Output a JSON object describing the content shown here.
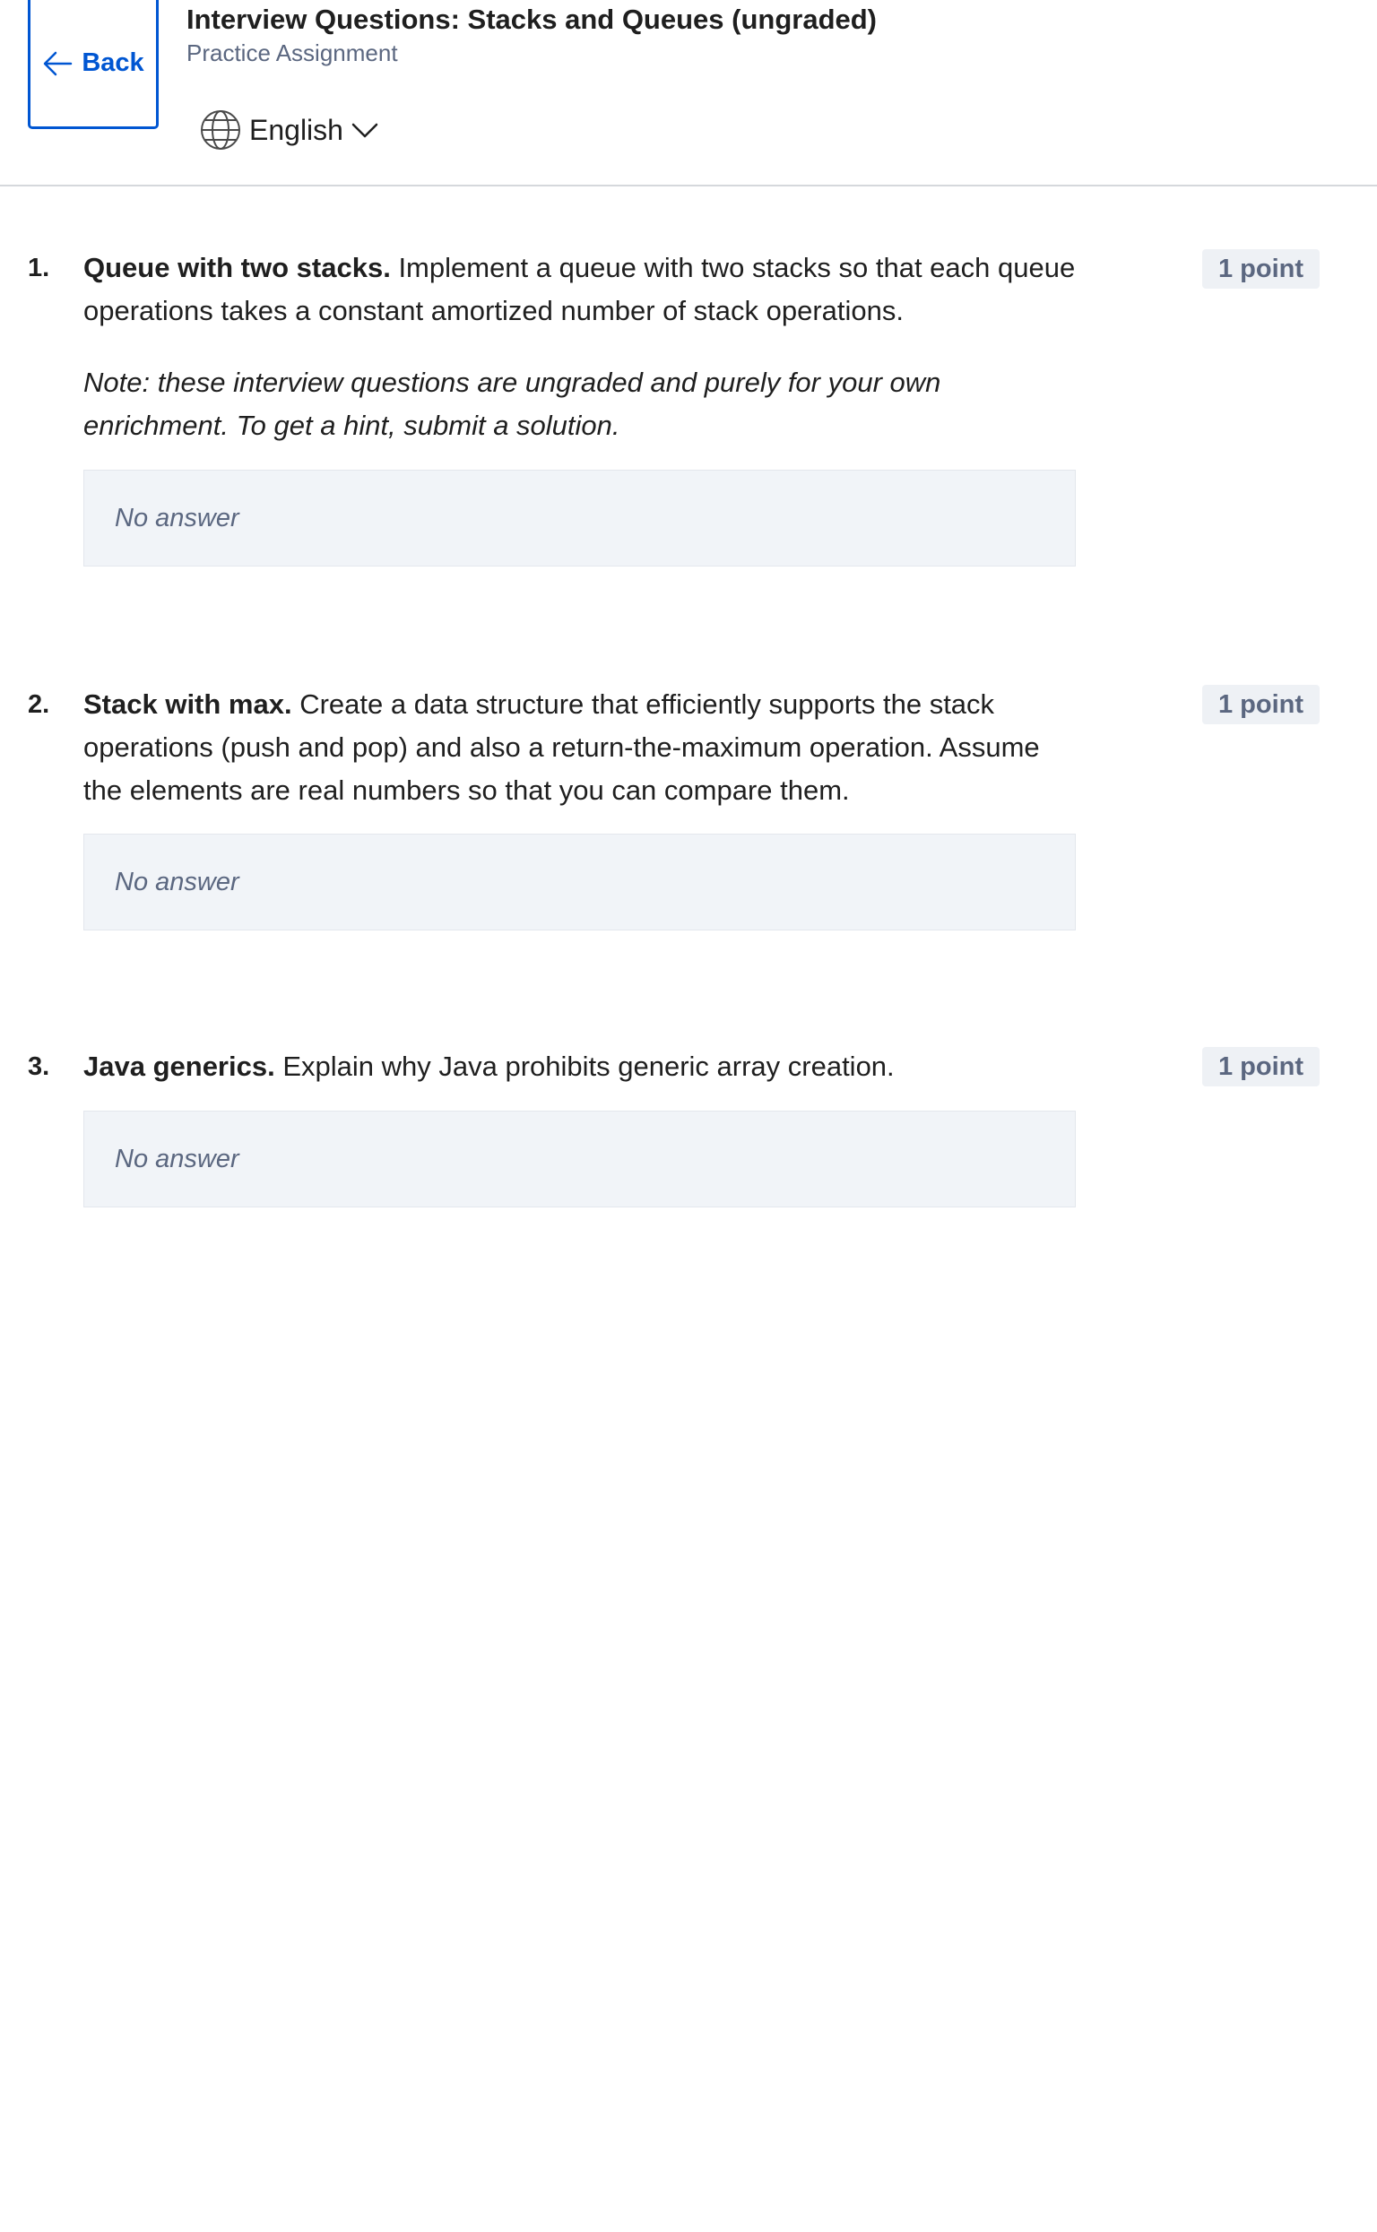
{
  "header": {
    "back_label": "Back",
    "title": "Interview Questions: Stacks and Queues (ungraded)",
    "subtitle": "Practice Assignment",
    "language": "English"
  },
  "questions": [
    {
      "number": "1.",
      "title": "Queue with two stacks.",
      "text": "Implement a queue with two stacks so that each queue operations takes a constant amortized number of stack operations.",
      "note": "Note: these interview questions are ungraded and purely for your own enrichment. To get a hint, submit a solution.",
      "points": "1 point",
      "answer": "No answer"
    },
    {
      "number": "2.",
      "title": "Stack with max.",
      "text": "Create a data structure that efficiently supports the stack operations (push and pop) and also a return-the-maximum operation. Assume the elements are real numbers so that you can compare them.",
      "points": "1 point",
      "answer": "No answer"
    },
    {
      "number": "3.",
      "title": "Java generics.",
      "text": "Explain why Java prohibits generic array creation.",
      "points": "1 point",
      "answer": "No answer"
    }
  ],
  "colors": {
    "accent": "#0056d2",
    "muted_text": "#5b6780",
    "answer_bg": "#f1f4f8",
    "points_bg": "#eef1f5"
  },
  "icons": {
    "back": "arrow-left-icon",
    "language": "globe-icon",
    "dropdown": "chevron-down-icon"
  }
}
